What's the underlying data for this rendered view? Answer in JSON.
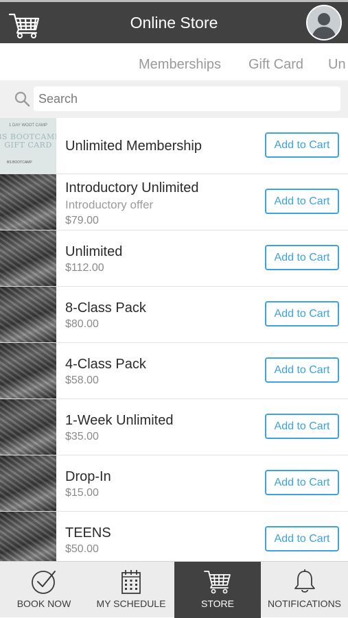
{
  "header": {
    "title": "Online Store",
    "cart_icon": "cart-icon",
    "avatar_icon": "user-avatar-icon"
  },
  "tabs": [
    {
      "label": "Memberships"
    },
    {
      "label": "Gift Card"
    },
    {
      "label": "Un"
    }
  ],
  "search": {
    "placeholder": "Search",
    "value": "",
    "icon": "search-icon"
  },
  "gift_card_thumb": {
    "line1": "1 DAY WOOT CAMP",
    "line2": "BS BOOTCAMP",
    "line3": "GIFT CARD",
    "line4": "BS BOOTCAMP"
  },
  "products": [
    {
      "name": "Unlimited Membership",
      "subtitle": "",
      "price": "",
      "thumb": "gift-card",
      "button": "Add to Cart"
    },
    {
      "name": "Introductory Unlimited",
      "subtitle": "Introductory offer",
      "price": "$79.00",
      "thumb": "photo",
      "button": "Add to Cart"
    },
    {
      "name": "Unlimited",
      "subtitle": "",
      "price": "$112.00",
      "thumb": "photo",
      "button": "Add to Cart"
    },
    {
      "name": "8-Class Pack",
      "subtitle": "",
      "price": "$80.00",
      "thumb": "photo",
      "button": "Add to Cart"
    },
    {
      "name": "4-Class Pack",
      "subtitle": "",
      "price": "$58.00",
      "thumb": "photo",
      "button": "Add to Cart"
    },
    {
      "name": "1-Week Unlimited",
      "subtitle": "",
      "price": "$35.00",
      "thumb": "photo",
      "button": "Add to Cart"
    },
    {
      "name": "Drop-In",
      "subtitle": "",
      "price": "$15.00",
      "thumb": "photo",
      "button": "Add to Cart"
    },
    {
      "name": "TEENS",
      "subtitle": "",
      "price": "$50.00",
      "thumb": "photo",
      "button": "Add to Cart"
    }
  ],
  "bottom_nav": [
    {
      "label": "BOOK NOW",
      "icon": "checkmark-circle-icon",
      "active": false
    },
    {
      "label": "MY SCHEDULE",
      "icon": "calendar-icon",
      "active": false
    },
    {
      "label": "STORE",
      "icon": "cart-icon",
      "active": true
    },
    {
      "label": "NOTIFICATIONS",
      "icon": "bell-icon",
      "active": false
    }
  ],
  "colors": {
    "header_bg": "#414141",
    "accent": "#3aa3dc",
    "nav_bg": "#ececec",
    "active_nav_bg": "#414141"
  }
}
